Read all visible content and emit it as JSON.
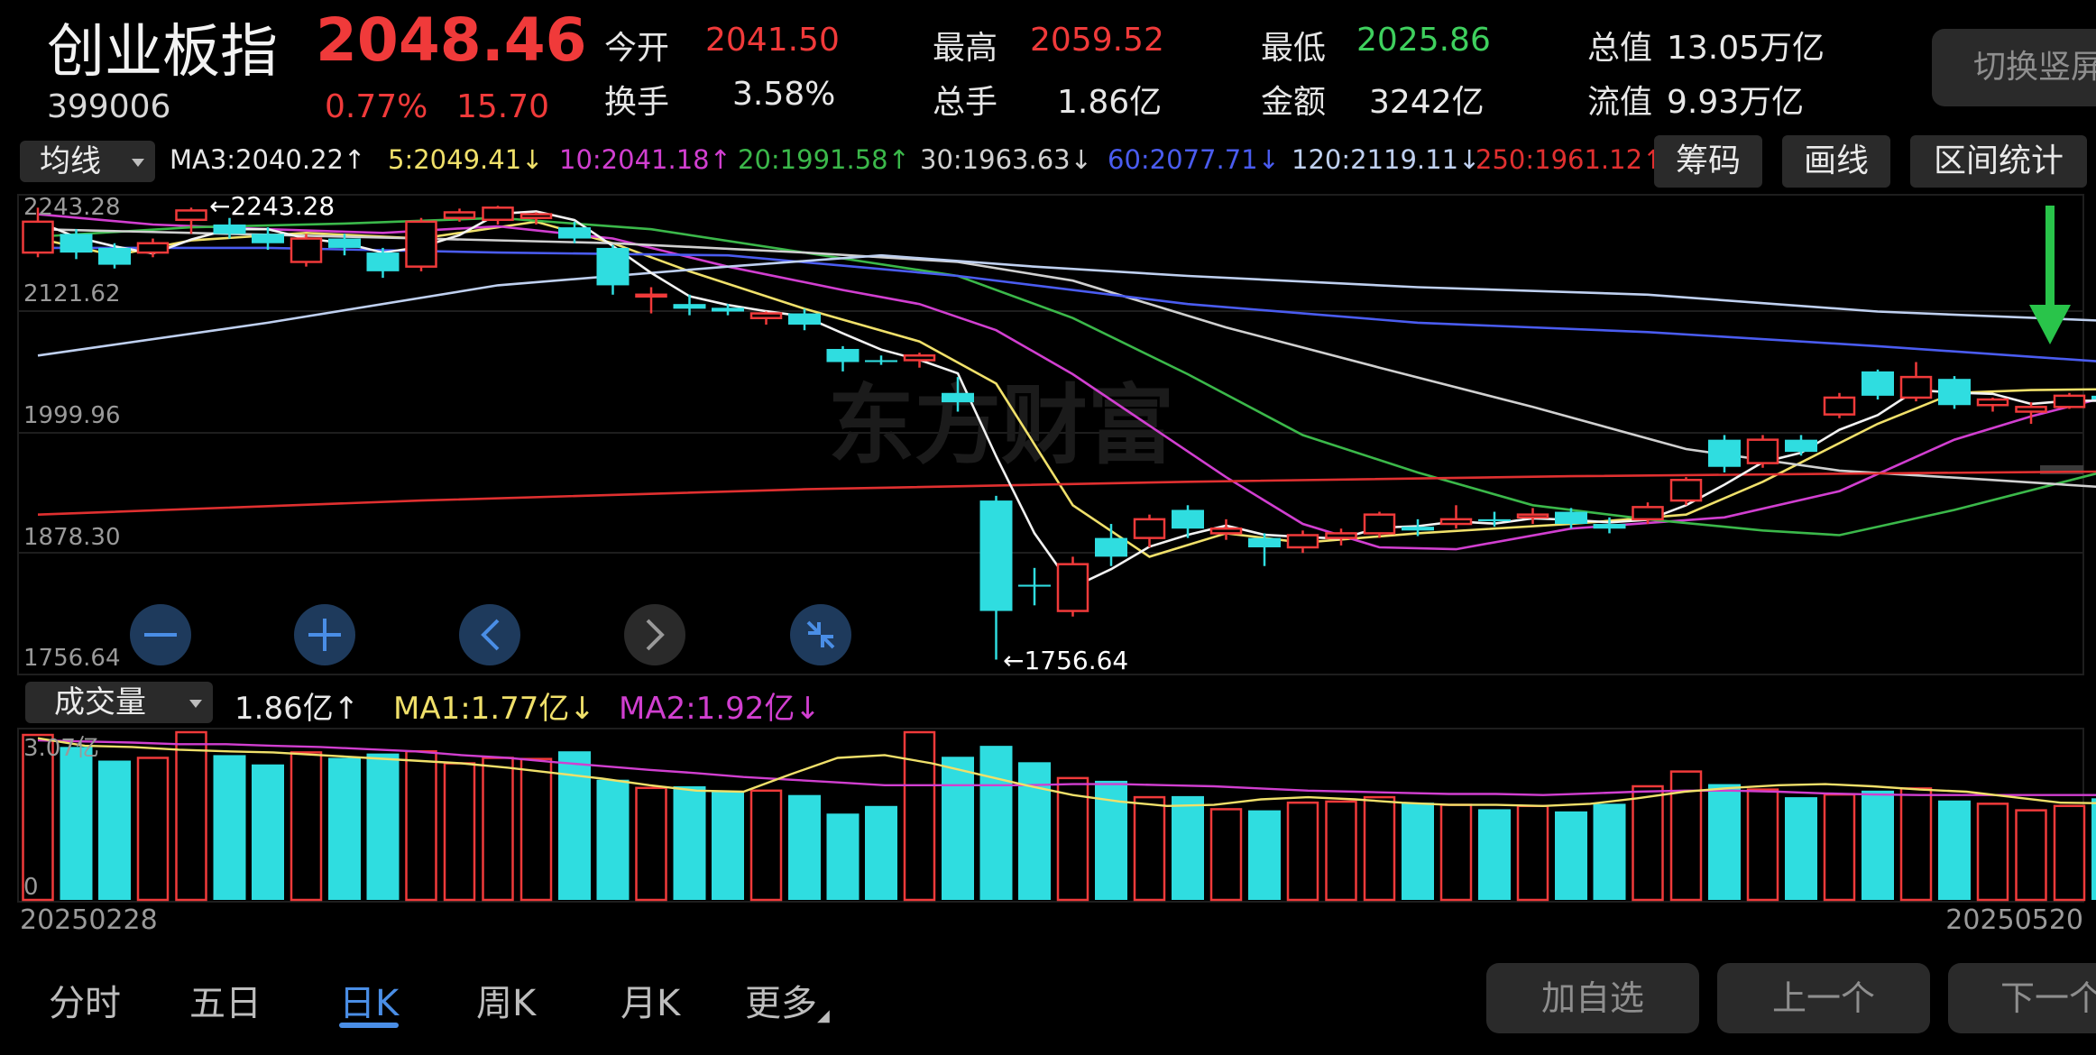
{
  "header": {
    "title": "创业板指",
    "price": "2048.46",
    "code": "399006",
    "change_pct": "0.77%",
    "change_val": "15.70",
    "stats": [
      {
        "label": "今开",
        "value": "2041.50",
        "color": "#f03a3a"
      },
      {
        "label": "最高",
        "value": "2059.52",
        "color": "#f03a3a"
      },
      {
        "label": "最低",
        "value": "2025.86",
        "color": "#3fd05e"
      },
      {
        "label": "总值",
        "value": "13.05万亿",
        "color": "#e8e8e8"
      },
      {
        "label": "换手",
        "value": "3.58%",
        "color": "#e8e8e8"
      },
      {
        "label": "总手",
        "value": "1.86亿",
        "color": "#e8e8e8"
      },
      {
        "label": "金额",
        "value": "3242亿",
        "color": "#e8e8e8"
      },
      {
        "label": "流值",
        "value": "9.93万亿",
        "color": "#e8e8e8"
      }
    ],
    "switch_label": "切换竖屏"
  },
  "ma_bar": {
    "selector": "均线",
    "items": [
      {
        "text": "MA3:2040.22↑",
        "color": "#e8e8e8"
      },
      {
        "text": "5:2049.41↓",
        "color": "#f0e06a"
      },
      {
        "text": "10:2041.18↑",
        "color": "#d13fd0"
      },
      {
        "text": "20:1991.58↑",
        "color": "#3bb84a"
      },
      {
        "text": "30:1963.63↓",
        "color": "#d0d0d0"
      },
      {
        "text": "60:2077.71↓",
        "color": "#4a5cf0"
      },
      {
        "text": "120:2119.11↓",
        "color": "#bfd0f0"
      },
      {
        "text": "250:1961.12↑",
        "color": "#e03030"
      }
    ],
    "buttons": [
      "筹码",
      "画线",
      "区间统计"
    ]
  },
  "price_axis": [
    "2243.28",
    "2121.62",
    "1999.96",
    "1878.30",
    "1756.64"
  ],
  "annotations": {
    "high": "←2243.28",
    "low": "←1756.64"
  },
  "watermark": "东方财富",
  "volume_bar": {
    "selector": "成交量",
    "value": "1.86亿↑",
    "ma1": "MA1:1.77亿↓",
    "ma2": "MA2:1.92亿↓",
    "axis_top": "3.07亿",
    "axis_bottom": "0"
  },
  "dates": {
    "start": "20250228",
    "end": "20250520"
  },
  "tabs": [
    "分时",
    "五日",
    "日K",
    "周K",
    "月K",
    "更多"
  ],
  "bottom_buttons": [
    "加自选",
    "上一个",
    "下一个"
  ],
  "colors": {
    "up": "#f03a3a",
    "down": "#2fdde0",
    "ma5": "#f0e06a",
    "ma10": "#d13fd0",
    "ma20": "#3bb84a",
    "ma30": "#d0d0d0",
    "ma60": "#4a5cf0",
    "ma120": "#bfd0f0",
    "ma250": "#e03030"
  },
  "chart_data": {
    "type": "candlestick",
    "y_range": [
      1756.64,
      2243.28
    ],
    "candles": [
      {
        "o": 2195,
        "c": 2228,
        "h": 2243,
        "l": 2190
      },
      {
        "o": 2215,
        "c": 2195,
        "h": 2220,
        "l": 2188
      },
      {
        "o": 2200,
        "c": 2182,
        "h": 2205,
        "l": 2178
      },
      {
        "o": 2195,
        "c": 2205,
        "h": 2210,
        "l": 2190
      },
      {
        "o": 2230,
        "c": 2240,
        "h": 2243,
        "l": 2215
      },
      {
        "o": 2225,
        "c": 2215,
        "h": 2232,
        "l": 2210
      },
      {
        "o": 2215,
        "c": 2205,
        "h": 2222,
        "l": 2198
      },
      {
        "o": 2185,
        "c": 2210,
        "h": 2215,
        "l": 2180
      },
      {
        "o": 2210,
        "c": 2200,
        "h": 2215,
        "l": 2192
      },
      {
        "o": 2195,
        "c": 2175,
        "h": 2200,
        "l": 2168
      },
      {
        "o": 2180,
        "c": 2228,
        "h": 2232,
        "l": 2175
      },
      {
        "o": 2232,
        "c": 2238,
        "h": 2242,
        "l": 2228
      },
      {
        "o": 2230,
        "c": 2243,
        "h": 2245,
        "l": 2225
      },
      {
        "o": 2232,
        "c": 2236,
        "h": 2238,
        "l": 2225
      },
      {
        "o": 2222,
        "c": 2210,
        "h": 2228,
        "l": 2205
      },
      {
        "o": 2200,
        "c": 2160,
        "h": 2203,
        "l": 2150
      },
      {
        "o": 2150,
        "c": 2150,
        "h": 2158,
        "l": 2130
      },
      {
        "o": 2140,
        "c": 2135,
        "h": 2150,
        "l": 2128
      },
      {
        "o": 2136,
        "c": 2132,
        "h": 2140,
        "l": 2128
      },
      {
        "o": 2125,
        "c": 2130,
        "h": 2132,
        "l": 2118
      },
      {
        "o": 2130,
        "c": 2118,
        "h": 2135,
        "l": 2112
      },
      {
        "o": 2092,
        "c": 2078,
        "h": 2095,
        "l": 2068
      },
      {
        "o": 2080,
        "c": 2078,
        "h": 2085,
        "l": 2075
      },
      {
        "o": 2080,
        "c": 2085,
        "h": 2088,
        "l": 2072
      },
      {
        "o": 2045,
        "c": 2035,
        "h": 2062,
        "l": 2025
      },
      {
        "o": 1930,
        "c": 1812,
        "h": 1935,
        "l": 1760
      },
      {
        "o": 1840,
        "c": 1838,
        "h": 1858,
        "l": 1818
      },
      {
        "o": 1812,
        "c": 1862,
        "h": 1870,
        "l": 1806
      },
      {
        "o": 1890,
        "c": 1870,
        "h": 1905,
        "l": 1860
      },
      {
        "o": 1890,
        "c": 1910,
        "h": 1915,
        "l": 1880
      },
      {
        "o": 1920,
        "c": 1900,
        "h": 1925,
        "l": 1890
      },
      {
        "o": 1895,
        "c": 1900,
        "h": 1910,
        "l": 1888
      },
      {
        "o": 1890,
        "c": 1880,
        "h": 1895,
        "l": 1860
      },
      {
        "o": 1880,
        "c": 1893,
        "h": 1898,
        "l": 1874
      },
      {
        "o": 1890,
        "c": 1895,
        "h": 1900,
        "l": 1882
      },
      {
        "o": 1895,
        "c": 1915,
        "h": 1918,
        "l": 1890
      },
      {
        "o": 1902,
        "c": 1898,
        "h": 1910,
        "l": 1892
      },
      {
        "o": 1905,
        "c": 1910,
        "h": 1925,
        "l": 1900
      },
      {
        "o": 1910,
        "c": 1908,
        "h": 1918,
        "l": 1902
      },
      {
        "o": 1912,
        "c": 1915,
        "h": 1922,
        "l": 1905
      },
      {
        "o": 1918,
        "c": 1905,
        "h": 1922,
        "l": 1900
      },
      {
        "o": 1905,
        "c": 1900,
        "h": 1912,
        "l": 1895
      },
      {
        "o": 1910,
        "c": 1923,
        "h": 1928,
        "l": 1905
      },
      {
        "o": 1930,
        "c": 1952,
        "h": 1955,
        "l": 1925
      },
      {
        "o": 1995,
        "c": 1966,
        "h": 2000,
        "l": 1960
      },
      {
        "o": 1970,
        "c": 1995,
        "h": 2000,
        "l": 1965
      },
      {
        "o": 1995,
        "c": 1982,
        "h": 2000,
        "l": 1978
      },
      {
        "o": 2022,
        "c": 2040,
        "h": 2045,
        "l": 2018
      },
      {
        "o": 2068,
        "c": 2042,
        "h": 2070,
        "l": 2038
      },
      {
        "o": 2040,
        "c": 2062,
        "h": 2078,
        "l": 2036
      },
      {
        "o": 2060,
        "c": 2032,
        "h": 2063,
        "l": 2028
      },
      {
        "o": 2032,
        "c": 2038,
        "h": 2040,
        "l": 2025
      },
      {
        "o": 2025,
        "c": 2030,
        "h": 2035,
        "l": 2012
      },
      {
        "o": 2030,
        "c": 2042,
        "h": 2045,
        "l": 2028
      },
      {
        "o": 2042,
        "c": 2038,
        "h": 2058,
        "l": 2025
      }
    ],
    "volumes": [
      3.02,
      2.8,
      2.55,
      2.6,
      3.07,
      2.65,
      2.48,
      2.7,
      2.6,
      2.68,
      2.72,
      2.5,
      2.6,
      2.58,
      2.72,
      2.2,
      2.05,
      2.08,
      1.98,
      2.0,
      1.92,
      1.58,
      1.72,
      3.07,
      2.62,
      2.82,
      2.52,
      2.23,
      2.18,
      1.88,
      1.9,
      1.66,
      1.64,
      1.78,
      1.8,
      1.88,
      1.78,
      1.74,
      1.66,
      1.72,
      1.62,
      1.76,
      2.08,
      2.35,
      2.12,
      2.02,
      1.88,
      1.93,
      2.0,
      2.04,
      1.82,
      1.76,
      1.64,
      1.72,
      1.86
    ],
    "ma_series": [
      {
        "name": "5",
        "color": "#f0e06a",
        "pts": [
          [
            0,
            2210
          ],
          [
            2,
            2192
          ],
          [
            4,
            2208
          ],
          [
            7,
            2216
          ],
          [
            10,
            2210
          ],
          [
            13,
            2228
          ],
          [
            15,
            2205
          ],
          [
            17,
            2175
          ],
          [
            20,
            2135
          ],
          [
            23,
            2100
          ],
          [
            25,
            2055
          ],
          [
            27,
            1925
          ],
          [
            29,
            1870
          ],
          [
            31,
            1895
          ],
          [
            33,
            1885
          ],
          [
            36,
            1895
          ],
          [
            40,
            1905
          ],
          [
            43,
            1915
          ],
          [
            45,
            1950
          ],
          [
            48,
            2012
          ],
          [
            50,
            2045
          ],
          [
            52,
            2048
          ],
          [
            54,
            2049
          ]
        ]
      },
      {
        "name": "10",
        "color": "#d13fd0",
        "pts": [
          [
            0,
            2236
          ],
          [
            3,
            2225
          ],
          [
            6,
            2220
          ],
          [
            9,
            2216
          ],
          [
            12,
            2223
          ],
          [
            15,
            2210
          ],
          [
            18,
            2180
          ],
          [
            21,
            2155
          ],
          [
            23,
            2140
          ],
          [
            25,
            2112
          ],
          [
            27,
            2065
          ],
          [
            29,
            2010
          ],
          [
            31,
            1955
          ],
          [
            33,
            1905
          ],
          [
            35,
            1880
          ],
          [
            37,
            1878
          ],
          [
            40,
            1900
          ],
          [
            44,
            1912
          ],
          [
            47,
            1940
          ],
          [
            50,
            1995
          ],
          [
            52,
            2020
          ],
          [
            54,
            2041
          ]
        ]
      },
      {
        "name": "20",
        "color": "#3bb84a",
        "pts": [
          [
            0,
            2212
          ],
          [
            4,
            2222
          ],
          [
            8,
            2226
          ],
          [
            12,
            2232
          ],
          [
            16,
            2220
          ],
          [
            20,
            2195
          ],
          [
            24,
            2170
          ],
          [
            27,
            2125
          ],
          [
            30,
            2065
          ],
          [
            33,
            2000
          ],
          [
            36,
            1960
          ],
          [
            39,
            1925
          ],
          [
            42,
            1910
          ],
          [
            45,
            1898
          ],
          [
            47,
            1893
          ],
          [
            50,
            1920
          ],
          [
            54,
            1962
          ]
        ]
      },
      {
        "name": "30",
        "color": "#d0d0d0",
        "pts": [
          [
            0,
            2220
          ],
          [
            5,
            2215
          ],
          [
            10,
            2210
          ],
          [
            15,
            2205
          ],
          [
            20,
            2195
          ],
          [
            24,
            2185
          ],
          [
            27,
            2165
          ],
          [
            31,
            2115
          ],
          [
            35,
            2072
          ],
          [
            39,
            2030
          ],
          [
            43,
            1985
          ],
          [
            47,
            1962
          ],
          [
            51,
            1952
          ],
          [
            54,
            1944
          ]
        ]
      },
      {
        "name": "60",
        "color": "#4a5cf0",
        "pts": [
          [
            0,
            2200
          ],
          [
            6,
            2200
          ],
          [
            12,
            2195
          ],
          [
            18,
            2192
          ],
          [
            24,
            2170
          ],
          [
            30,
            2140
          ],
          [
            36,
            2120
          ],
          [
            42,
            2110
          ],
          [
            48,
            2095
          ],
          [
            54,
            2078
          ]
        ]
      },
      {
        "name": "120",
        "color": "#bfd0f0",
        "pts": [
          [
            0,
            2085
          ],
          [
            6,
            2120
          ],
          [
            12,
            2160
          ],
          [
            18,
            2180
          ],
          [
            22,
            2192
          ],
          [
            26,
            2180
          ],
          [
            30,
            2170
          ],
          [
            36,
            2158
          ],
          [
            42,
            2150
          ],
          [
            48,
            2132
          ],
          [
            54,
            2122
          ]
        ]
      },
      {
        "name": "250",
        "color": "#e03030",
        "pts": [
          [
            0,
            1915
          ],
          [
            10,
            1930
          ],
          [
            20,
            1942
          ],
          [
            30,
            1950
          ],
          [
            40,
            1956
          ],
          [
            48,
            1959
          ],
          [
            54,
            1961
          ]
        ]
      }
    ],
    "vol_ma1": [
      2.96,
      2.82,
      2.8,
      2.75,
      2.72,
      2.7,
      2.65,
      2.6,
      2.55,
      2.5,
      2.42,
      2.32,
      2.22,
      2.1,
      2.0,
      1.98,
      2.3,
      2.6,
      2.65,
      2.5,
      2.3,
      2.1,
      1.92,
      1.8,
      1.72,
      1.74,
      1.84,
      1.88,
      1.84,
      1.78,
      1.74,
      1.74,
      1.72,
      1.76,
      1.86,
      1.98,
      2.05,
      2.1,
      2.12,
      2.08,
      2.02,
      1.98,
      1.88,
      1.78,
      1.77
    ],
    "vol_ma2": [
      2.92,
      2.9,
      2.88,
      2.85,
      2.85,
      2.82,
      2.8,
      2.76,
      2.72,
      2.65,
      2.6,
      2.52,
      2.45,
      2.38,
      2.32,
      2.25,
      2.2,
      2.15,
      2.1,
      2.1,
      2.1,
      2.1,
      2.12,
      2.12,
      2.1,
      2.08,
      2.04,
      2.0,
      1.98,
      1.96,
      1.94,
      1.94,
      1.92,
      1.95,
      1.98,
      2.0,
      2.0,
      1.98,
      1.95,
      1.93,
      1.92,
      1.92,
      1.92,
      1.92,
      1.92
    ]
  }
}
